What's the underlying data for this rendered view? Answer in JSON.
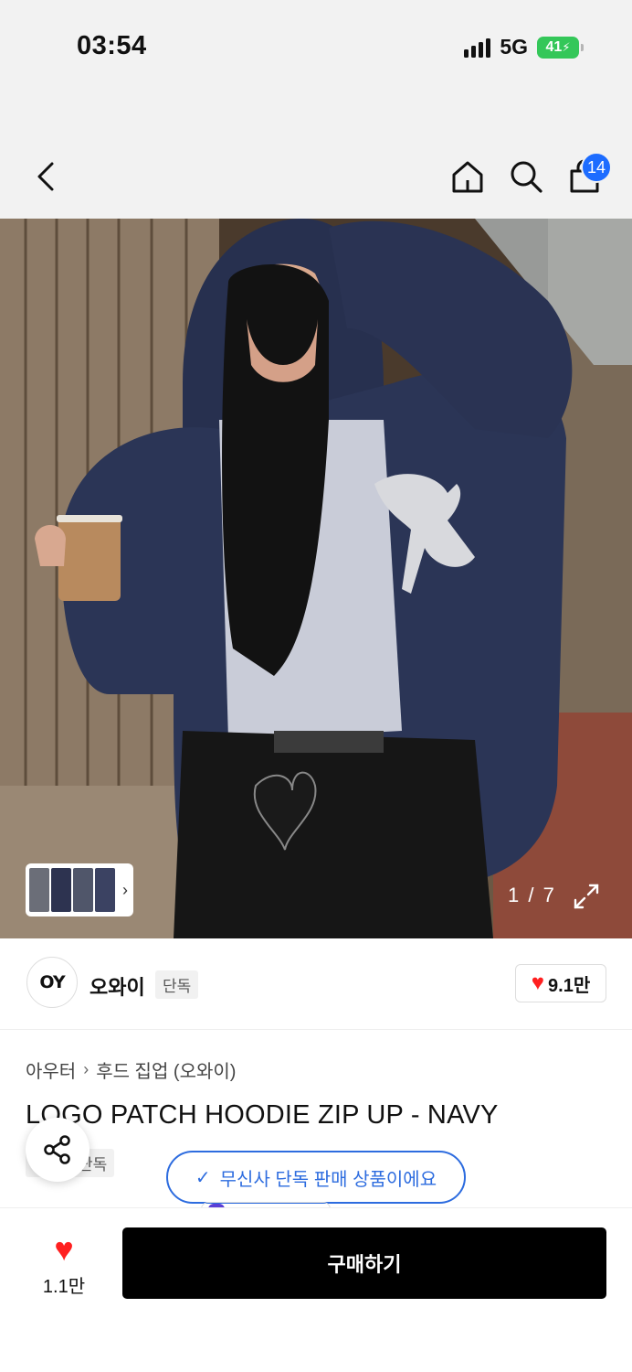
{
  "status_bar": {
    "time": "03:54",
    "network": "5G",
    "battery": "41"
  },
  "nav": {
    "cart_count": "14"
  },
  "gallery": {
    "counter": "1 / 7",
    "chevron": "›"
  },
  "brand": {
    "logo_text": "OY",
    "name": "오와이",
    "tag": "단독",
    "likes": "9.1만"
  },
  "product": {
    "breadcrumb": [
      "아우터",
      "후드 집업 (오와이)"
    ],
    "breadcrumb_sep": "›",
    "title": "LOGO PATCH HOODIE ZIP UP - NAVY",
    "tag": "단독",
    "exclusive_notice": "무신사 단독 판매 상품이에요"
  },
  "bottom": {
    "wish_count": "1.1만",
    "buy_label": "구매하기"
  },
  "colors": {
    "accent_blue": "#1d6cff",
    "notice_blue": "#2d6cdf",
    "heart_red": "#ff1f1f",
    "buy_black": "#000000"
  },
  "icons": {
    "heart": "♥",
    "check": "✓"
  }
}
